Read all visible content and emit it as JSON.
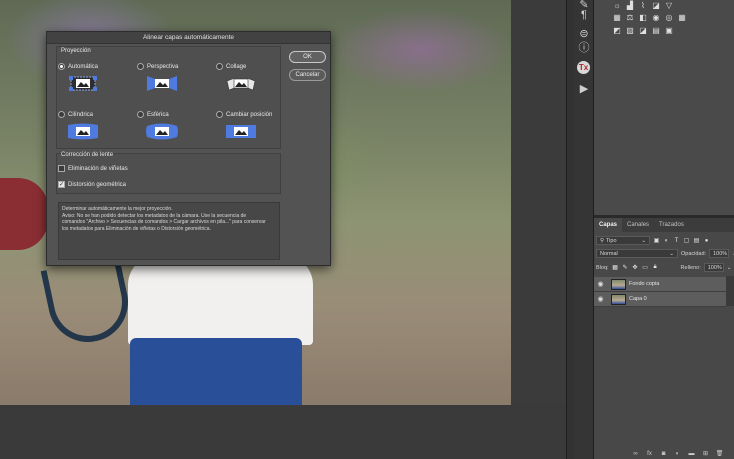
{
  "dialog": {
    "title": "Alinear capas automáticamente",
    "projection_label": "Proyección",
    "projection_options": [
      {
        "label": "Automática",
        "selected": true
      },
      {
        "label": "Perspectiva",
        "selected": false
      },
      {
        "label": "Collage",
        "selected": false
      },
      {
        "label": "Cilíndrica",
        "selected": false
      },
      {
        "label": "Esférica",
        "selected": false
      },
      {
        "label": "Cambiar posición",
        "selected": false
      }
    ],
    "lens_label": "Corrección de lente",
    "lens_options": [
      {
        "label": "Eliminación de viñetas",
        "checked": false
      },
      {
        "label": "Distorsión geométrica",
        "checked": true
      }
    ],
    "ok_label": "OK",
    "cancel_label": "Cancelar",
    "info_lines": [
      "Determinar automáticamente la mejor proyección.",
      "",
      "Aviso: No se han podido detectar los metadatos de la cámara. Use la secuencia de",
      "comandos \"Archivo > Secuencias de comandos > Cargar archivos en pila...\" para conservar",
      "los metadatos para Eliminación de viñetas o Distorsión geométrica."
    ]
  },
  "layers_panel": {
    "tabs": [
      "Capas",
      "Canales",
      "Trazados"
    ],
    "filter_label": "Tipo",
    "blend_mode": "Normal",
    "opacity_label": "Opacidad:",
    "opacity_value": "100%",
    "lock_label": "Bloq:",
    "fill_label": "Relleno:",
    "fill_value": "100%",
    "layers": [
      {
        "name": "Fondo copia",
        "selected": true
      },
      {
        "name": "Capa 0",
        "selected": true
      }
    ]
  },
  "colors": {
    "dialog_bg": "#535353",
    "panel_bg": "#484848",
    "selected_layer": "#5d5d5d",
    "tx_icon": "#b0252a"
  }
}
